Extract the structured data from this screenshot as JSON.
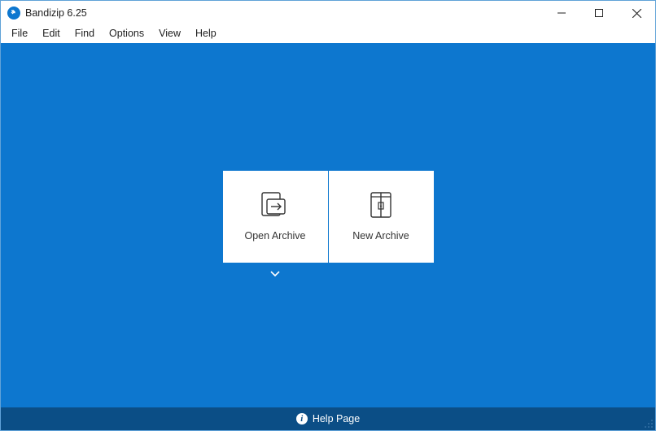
{
  "app": {
    "title": "Bandizip 6.25"
  },
  "menu": {
    "file": "File",
    "edit": "Edit",
    "find": "Find",
    "options": "Options",
    "view": "View",
    "help": "Help"
  },
  "tiles": {
    "open_label": "Open Archive",
    "new_label": "New Archive"
  },
  "status": {
    "help_label": "Help Page"
  }
}
